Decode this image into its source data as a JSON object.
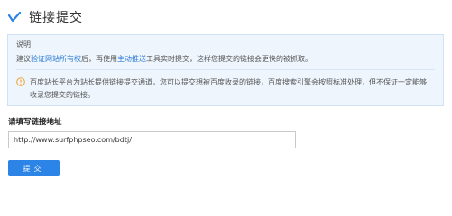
{
  "header": {
    "title": "链接提交",
    "icon": "brand-check-icon"
  },
  "notice": {
    "heading": "说明",
    "line1_prefix": "建议",
    "verify_link": "验证网站所有权",
    "line1_mid": "后，再使用",
    "active_push_link": "主动推送",
    "line1_suffix": "工具实时提交，这样您提交的链接会更快的被抓取。",
    "warning": "百度站长平台为站长提供链接提交通道，您可以提交想被百度收录的链接，百度搜索引擎会按照标准处理，但不保证一定能够收录您提交的链接。",
    "link_color": "#2b7bd6",
    "background_color": "#eef5fd",
    "warning_icon_color": "#f0a030"
  },
  "form": {
    "label": "请填写链接地址",
    "url_value": "http://www.surfphpseo.com/bdtj/",
    "submit_label": "提交",
    "button_color": "#2b84e6"
  }
}
